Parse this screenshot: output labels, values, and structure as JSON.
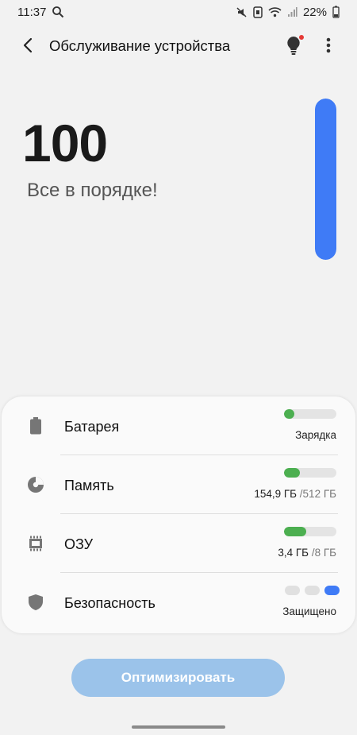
{
  "status_bar": {
    "time": "11:37",
    "battery": "22%",
    "icons": [
      "search-icon",
      "mute-icon",
      "nfc-icon",
      "wifi-icon",
      "signal-icon",
      "battery-icon"
    ]
  },
  "app_bar": {
    "title": "Обслуживание устройства",
    "back_icon": "back-arrow-icon",
    "tips_icon": "lightbulb-icon",
    "more_icon": "more-vert-icon"
  },
  "score": {
    "value": "100",
    "status": "Все в порядке!",
    "gauge_level": 1.0,
    "gauge_color": "#3f7bf6"
  },
  "items": [
    {
      "label": "Батарея",
      "icon": "battery-icon",
      "value": "Зарядка",
      "sub": "",
      "level": 0.2
    },
    {
      "label": "Память",
      "icon": "storage-pie-icon",
      "value": "154,9 ГБ",
      "sub": "/512 ГБ",
      "level": 0.3
    },
    {
      "label": "ОЗУ",
      "icon": "memory-chip-icon",
      "value": "3,4 ГБ",
      "sub": "/8 ГБ",
      "level": 0.42
    },
    {
      "label": "Безопасность",
      "icon": "shield-icon",
      "value": "Защищено",
      "sub": "",
      "security_level": 3
    }
  ],
  "colors": {
    "accent": "#3f7bf6",
    "good": "#4caf50",
    "button": "#9bc3ea"
  },
  "optimize_button": "Оптимизировать"
}
